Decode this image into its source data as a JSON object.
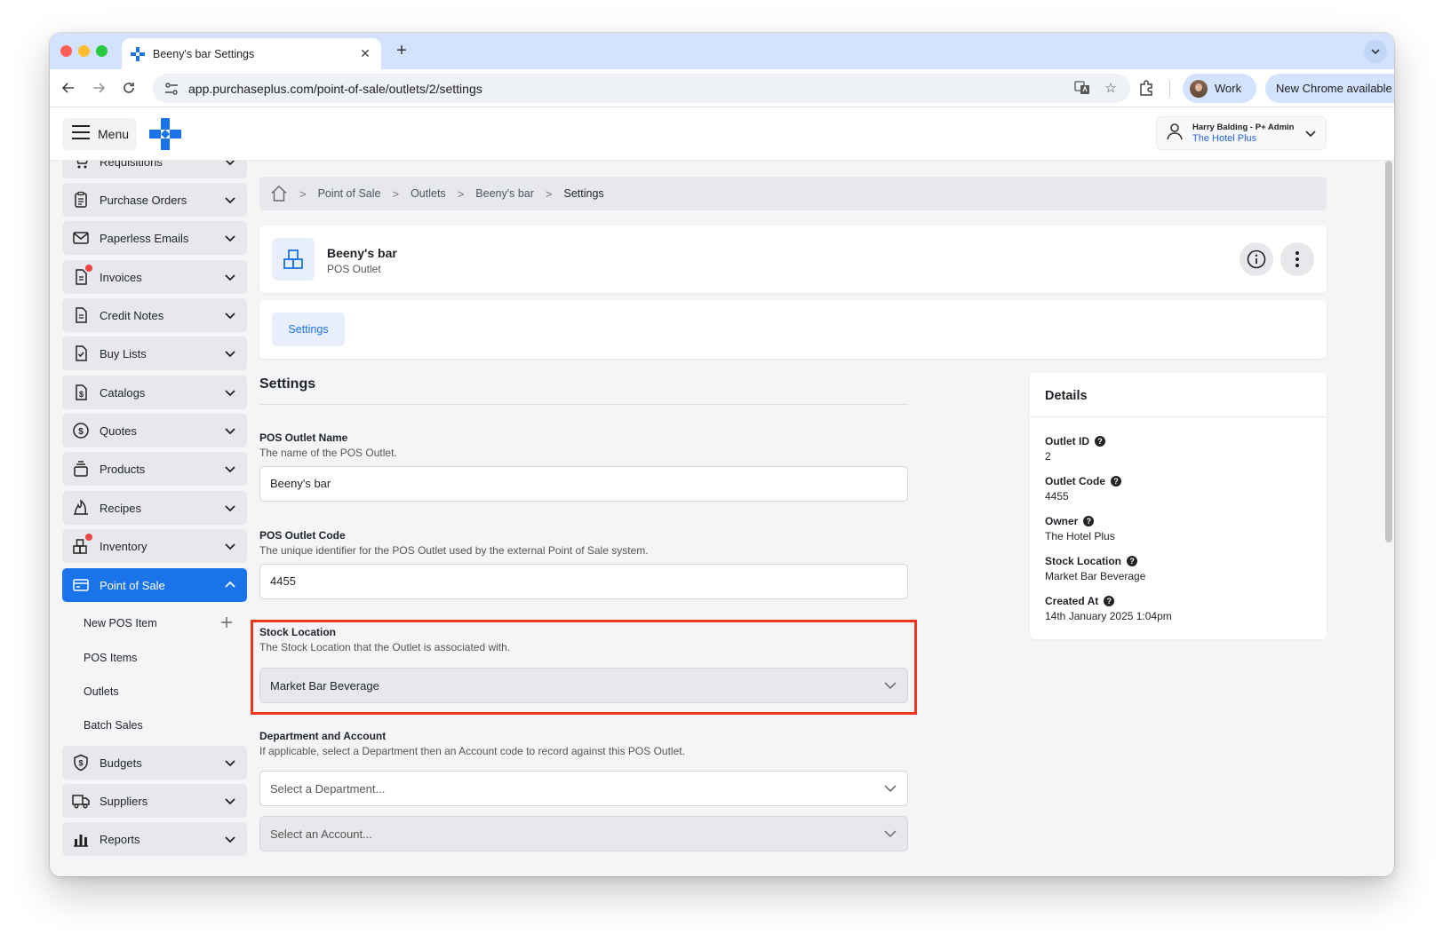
{
  "browser": {
    "tab_title": "Beeny's bar Settings",
    "tab_close": "✕",
    "new_tab": "+",
    "url": "app.purchaseplus.com/point-of-sale/outlets/2/settings",
    "profile_name": "Work",
    "update_label": "New Chrome available"
  },
  "header": {
    "menu_label": "Menu",
    "user_name": "Harry Balding - P+ Admin",
    "user_org": "The Hotel Plus"
  },
  "sidebar": {
    "items": [
      {
        "label": "Requisitions",
        "icon": "cart-icon"
      },
      {
        "label": "Purchase Orders",
        "icon": "clipboard-icon"
      },
      {
        "label": "Paperless Emails",
        "icon": "envelope-icon"
      },
      {
        "label": "Invoices",
        "icon": "invoice-icon"
      },
      {
        "label": "Credit Notes",
        "icon": "document-icon"
      },
      {
        "label": "Buy Lists",
        "icon": "checklist-icon"
      },
      {
        "label": "Catalogs",
        "icon": "dollar-doc-icon"
      },
      {
        "label": "Quotes",
        "icon": "dollar-circle-icon"
      },
      {
        "label": "Products",
        "icon": "stack-icon"
      },
      {
        "label": "Recipes",
        "icon": "flame-icon"
      },
      {
        "label": "Inventory",
        "icon": "boxes-icon"
      },
      {
        "label": "Point of Sale",
        "icon": "card-icon"
      }
    ],
    "pos_sub_items": [
      {
        "label": "New POS Item"
      },
      {
        "label": "POS Items"
      },
      {
        "label": "Outlets"
      },
      {
        "label": "Batch Sales"
      }
    ],
    "bottom_items": [
      {
        "label": "Budgets",
        "icon": "shield-dollar-icon"
      },
      {
        "label": "Suppliers",
        "icon": "truck-icon"
      },
      {
        "label": "Reports",
        "icon": "bar-chart-icon"
      }
    ]
  },
  "breadcrumb": {
    "items": [
      "Point of Sale",
      "Outlets",
      "Beeny's bar"
    ],
    "current": "Settings",
    "separator": ">"
  },
  "outlet": {
    "name": "Beeny's bar",
    "type": "POS Outlet"
  },
  "tabs": {
    "active": "Settings"
  },
  "settings": {
    "title": "Settings",
    "name_label": "POS Outlet Name",
    "name_help": "The name of the POS Outlet.",
    "name_value": "Beeny's bar",
    "code_label": "POS Outlet Code",
    "code_help": "The unique identifier for the POS Outlet used by the external Point of Sale system.",
    "code_value": "4455",
    "stock_label": "Stock Location",
    "stock_help": "The Stock Location that the Outlet is associated with.",
    "stock_value": "Market Bar Beverage",
    "dept_label": "Department and Account",
    "dept_help": "If applicable, select a Department then an Account code to record against this POS Outlet.",
    "dept_placeholder": "Select a Department...",
    "account_placeholder": "Select an Account..."
  },
  "details": {
    "title": "Details",
    "help_glyph": "?",
    "fields": [
      {
        "label": "Outlet ID",
        "value": "2"
      },
      {
        "label": "Outlet Code",
        "value": "4455"
      },
      {
        "label": "Owner",
        "value": "The Hotel Plus"
      },
      {
        "label": "Stock Location",
        "value": "Market Bar Beverage"
      },
      {
        "label": "Created At",
        "value": "14th January 2025 1:04pm"
      }
    ]
  },
  "colors": {
    "primary": "#1a73e8",
    "highlight": "#f0341d",
    "notification_dot": "#ef4444"
  }
}
